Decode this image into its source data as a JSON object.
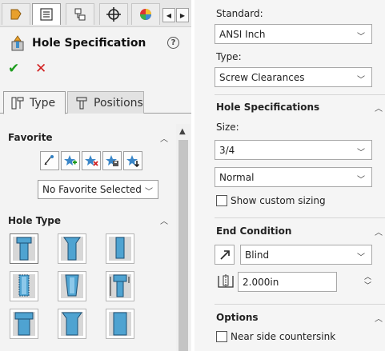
{
  "left_panel": {
    "title": "Hole Specification",
    "help_label": "?",
    "tabs": [
      {
        "label": "Type",
        "icon": "type-tab-icon"
      },
      {
        "label": "Positions",
        "icon": "positions-tab-icon"
      }
    ],
    "favorite": {
      "title": "Favorite",
      "buttons": [
        "apply-defaults-icon",
        "add-favorite-icon",
        "delete-favorite-icon",
        "save-favorite-icon",
        "load-favorite-icon"
      ],
      "selected": "No Favorite Selected"
    },
    "hole_type": {
      "title": "Hole Type",
      "types": [
        "counterbore",
        "countersink",
        "hole",
        "straight-tap",
        "tapered-tap",
        "legacy-hole",
        "counterbore-slot",
        "countersink-slot",
        "slot"
      ]
    }
  },
  "right_panel": {
    "standard": {
      "label": "Standard:",
      "value": "ANSI Inch"
    },
    "type": {
      "label": "Type:",
      "value": "Screw Clearances"
    },
    "hole_specifications": {
      "title": "Hole Specifications",
      "size_label": "Size:",
      "size_value": "3/4",
      "fit_value": "Normal",
      "custom_sizing_label": "Show custom sizing"
    },
    "end_condition": {
      "title": "End Condition",
      "value": "Blind",
      "depth": "2.000in"
    },
    "options": {
      "title": "Options",
      "near_side_countersink_label": "Near side countersink"
    }
  },
  "colors": {
    "ok": "#1e9d1e",
    "cancel": "#d11f1f",
    "hole_blue": "#4fa3d1"
  }
}
